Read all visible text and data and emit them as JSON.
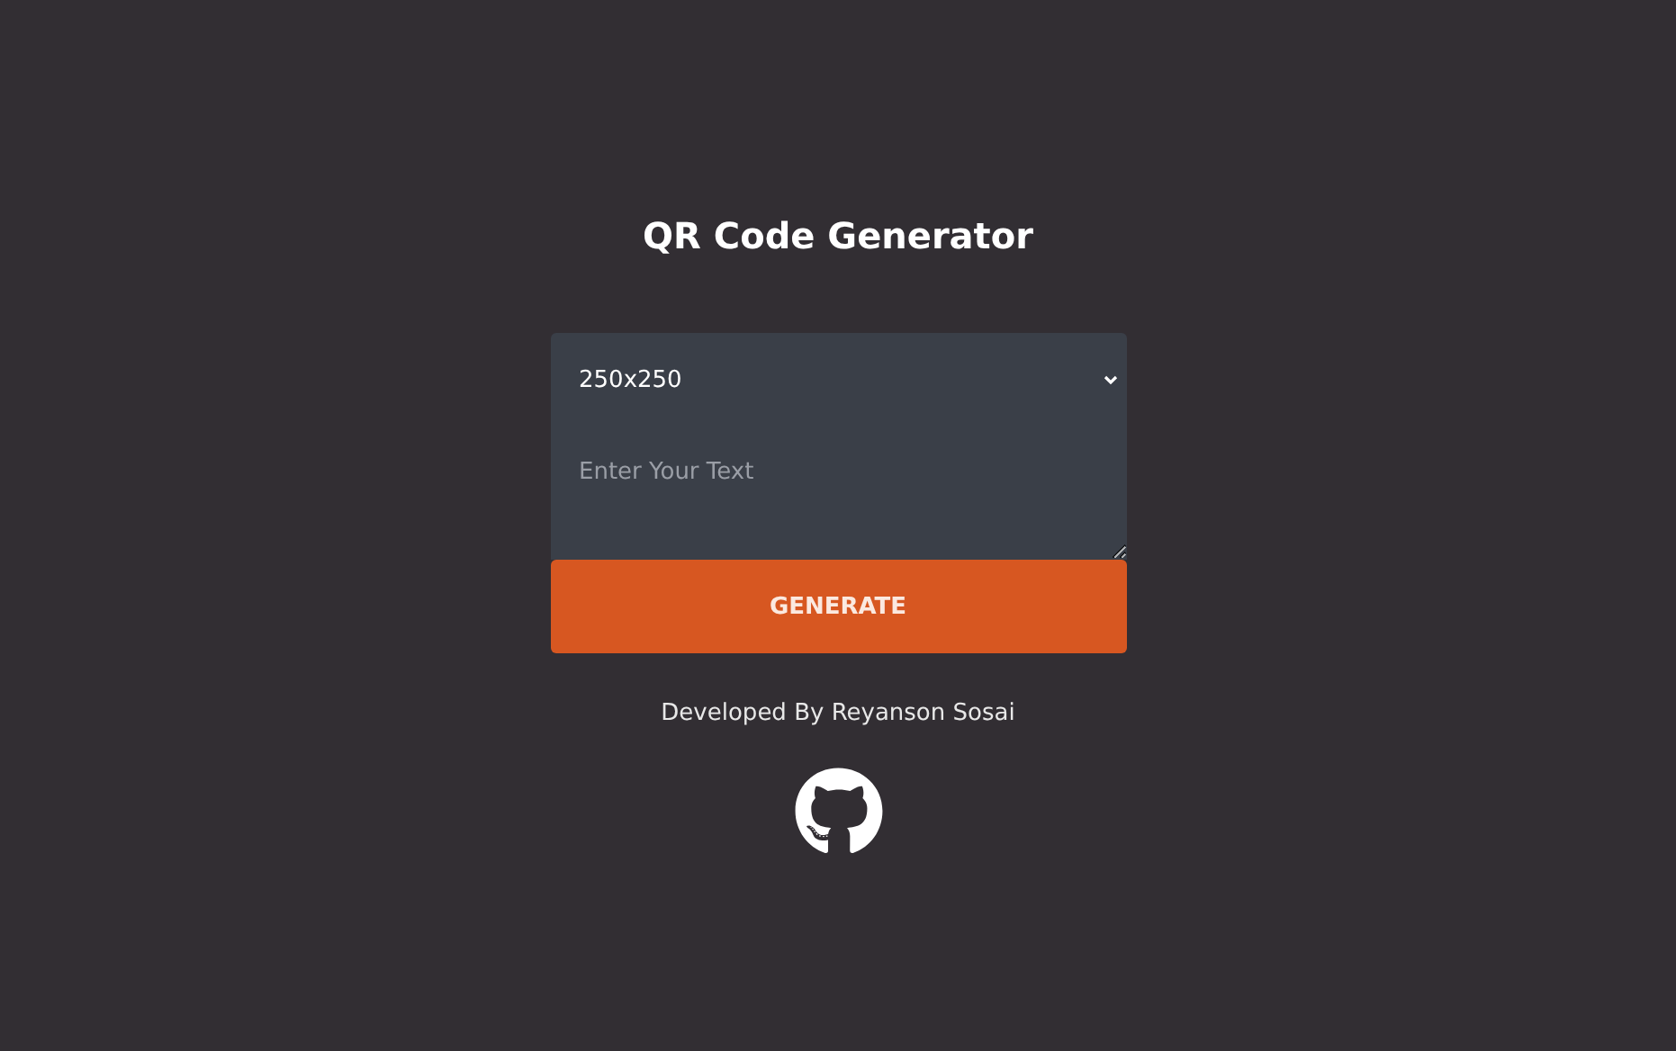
{
  "title": "QR Code Generator",
  "size_select": {
    "value": "250x250"
  },
  "text_input": {
    "placeholder": "Enter Your Text"
  },
  "generate_button": {
    "label": "GENERATE"
  },
  "footer": {
    "credit": "Developed By Reyanson Sosai"
  }
}
